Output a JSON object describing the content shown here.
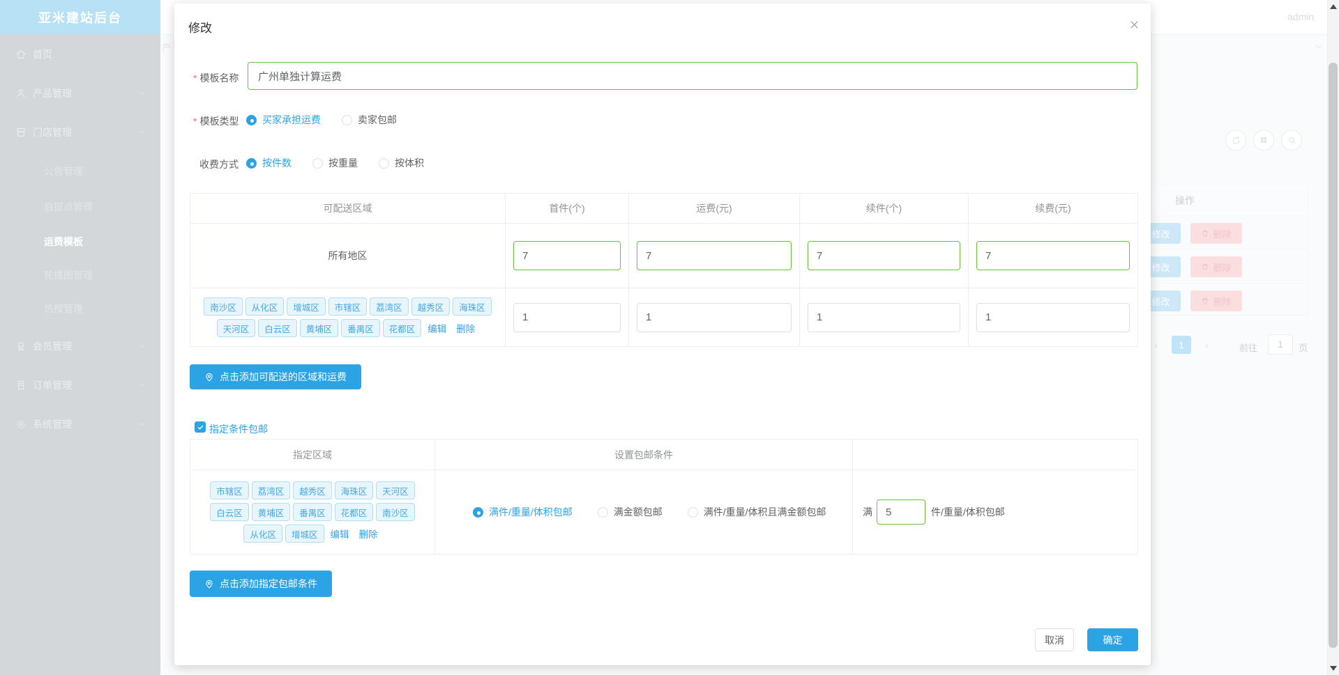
{
  "app": {
    "sidebar_title": "亚米建站后台"
  },
  "topbar": {
    "username": "admin",
    "clipped_text": "产"
  },
  "sidebar": {
    "items": [
      {
        "icon": "home-icon",
        "label": "首页"
      },
      {
        "icon": "user-icon",
        "label": "产品管理",
        "chevron": "down"
      },
      {
        "icon": "shop-icon",
        "label": "门店管理",
        "chevron": "up",
        "expanded": true
      },
      {
        "label": "公告管理",
        "sub": true
      },
      {
        "label": "自提点管理",
        "sub": true
      },
      {
        "label": "运费模板",
        "sub": true,
        "active": true
      },
      {
        "label": "轮播图管理",
        "sub": true
      },
      {
        "label": "热搜管理",
        "sub": true
      },
      {
        "icon": "medal-icon",
        "label": "会员管理",
        "chevron": "down"
      },
      {
        "icon": "order-icon",
        "label": "订单管理",
        "chevron": "down"
      },
      {
        "icon": "gear-icon",
        "label": "系统管理",
        "chevron": "down"
      }
    ]
  },
  "background": {
    "toolbar_icons": [
      "refresh-icon",
      "grid-icon",
      "search-icon"
    ],
    "ops_header": "操作",
    "edit_label": "修改",
    "delete_label": "删除",
    "pagination": {
      "prev": "‹",
      "page": "1",
      "next": "›",
      "goto_label": "前往",
      "goto_value": "1",
      "unit": "页"
    }
  },
  "modal": {
    "title": "修改",
    "name_field": {
      "label": "模板名称",
      "required": true,
      "value": "广州单独计算运费"
    },
    "type_field": {
      "label": "模板类型",
      "required": true,
      "options": [
        {
          "label": "买家承担运费",
          "selected": true
        },
        {
          "label": "卖家包邮",
          "selected": false
        }
      ]
    },
    "charge_field": {
      "label": "收费方式",
      "options": [
        {
          "label": "按件数",
          "selected": true
        },
        {
          "label": "按重量",
          "selected": false
        },
        {
          "label": "按体积",
          "selected": false
        }
      ]
    },
    "table1": {
      "headers": [
        "可配送区域",
        "首件(个)",
        "运费(元)",
        "续件(个)",
        "续费(元)"
      ],
      "row_all": {
        "region": "所有地区",
        "values": [
          "7",
          "7",
          "7",
          "7"
        ]
      },
      "row_custom": {
        "tag_line1": [
          "南沙区",
          "从化区",
          "增城区",
          "市辖区",
          "荔湾区",
          "越秀区",
          "海珠区"
        ],
        "tag_line2": [
          "天河区",
          "白云区",
          "黄埔区",
          "番禺区",
          "花都区"
        ],
        "edit_label": "编辑",
        "delete_label": "删除",
        "values": [
          "1",
          "1",
          "1",
          "1"
        ]
      }
    },
    "add_region_button": "点击添加可配送的区域和运费",
    "free_shipping_checkbox": {
      "checked": true,
      "label": "指定条件包邮"
    },
    "table2": {
      "headers": [
        "指定区域",
        "设置包邮条件",
        ""
      ],
      "tag_line1": [
        "市辖区",
        "荔湾区",
        "越秀区",
        "海珠区",
        "天河区"
      ],
      "tag_line2": [
        "白云区",
        "黄埔区",
        "番禺区",
        "花都区",
        "南沙区"
      ],
      "tag_line3": [
        "从化区",
        "增城区"
      ],
      "edit_label": "编辑",
      "delete_label": "删除",
      "conditions": [
        {
          "label": "满件/重量/体积包邮",
          "selected": true
        },
        {
          "label": "满金额包邮",
          "selected": false
        },
        {
          "label": "满件/重量/体积且满金额包邮",
          "selected": false
        }
      ],
      "threshold": {
        "prefix": "满",
        "value": "5",
        "suffix": "件/重量/体积包邮"
      }
    },
    "add_condition_button": "点击添加指定包邮条件",
    "footer": {
      "cancel": "取消",
      "confirm": "确定"
    }
  },
  "colors": {
    "accent": "#2ba3e5",
    "success_border": "#67c23a",
    "required": "#f56c6c",
    "tag_text": "#47a7e0"
  }
}
